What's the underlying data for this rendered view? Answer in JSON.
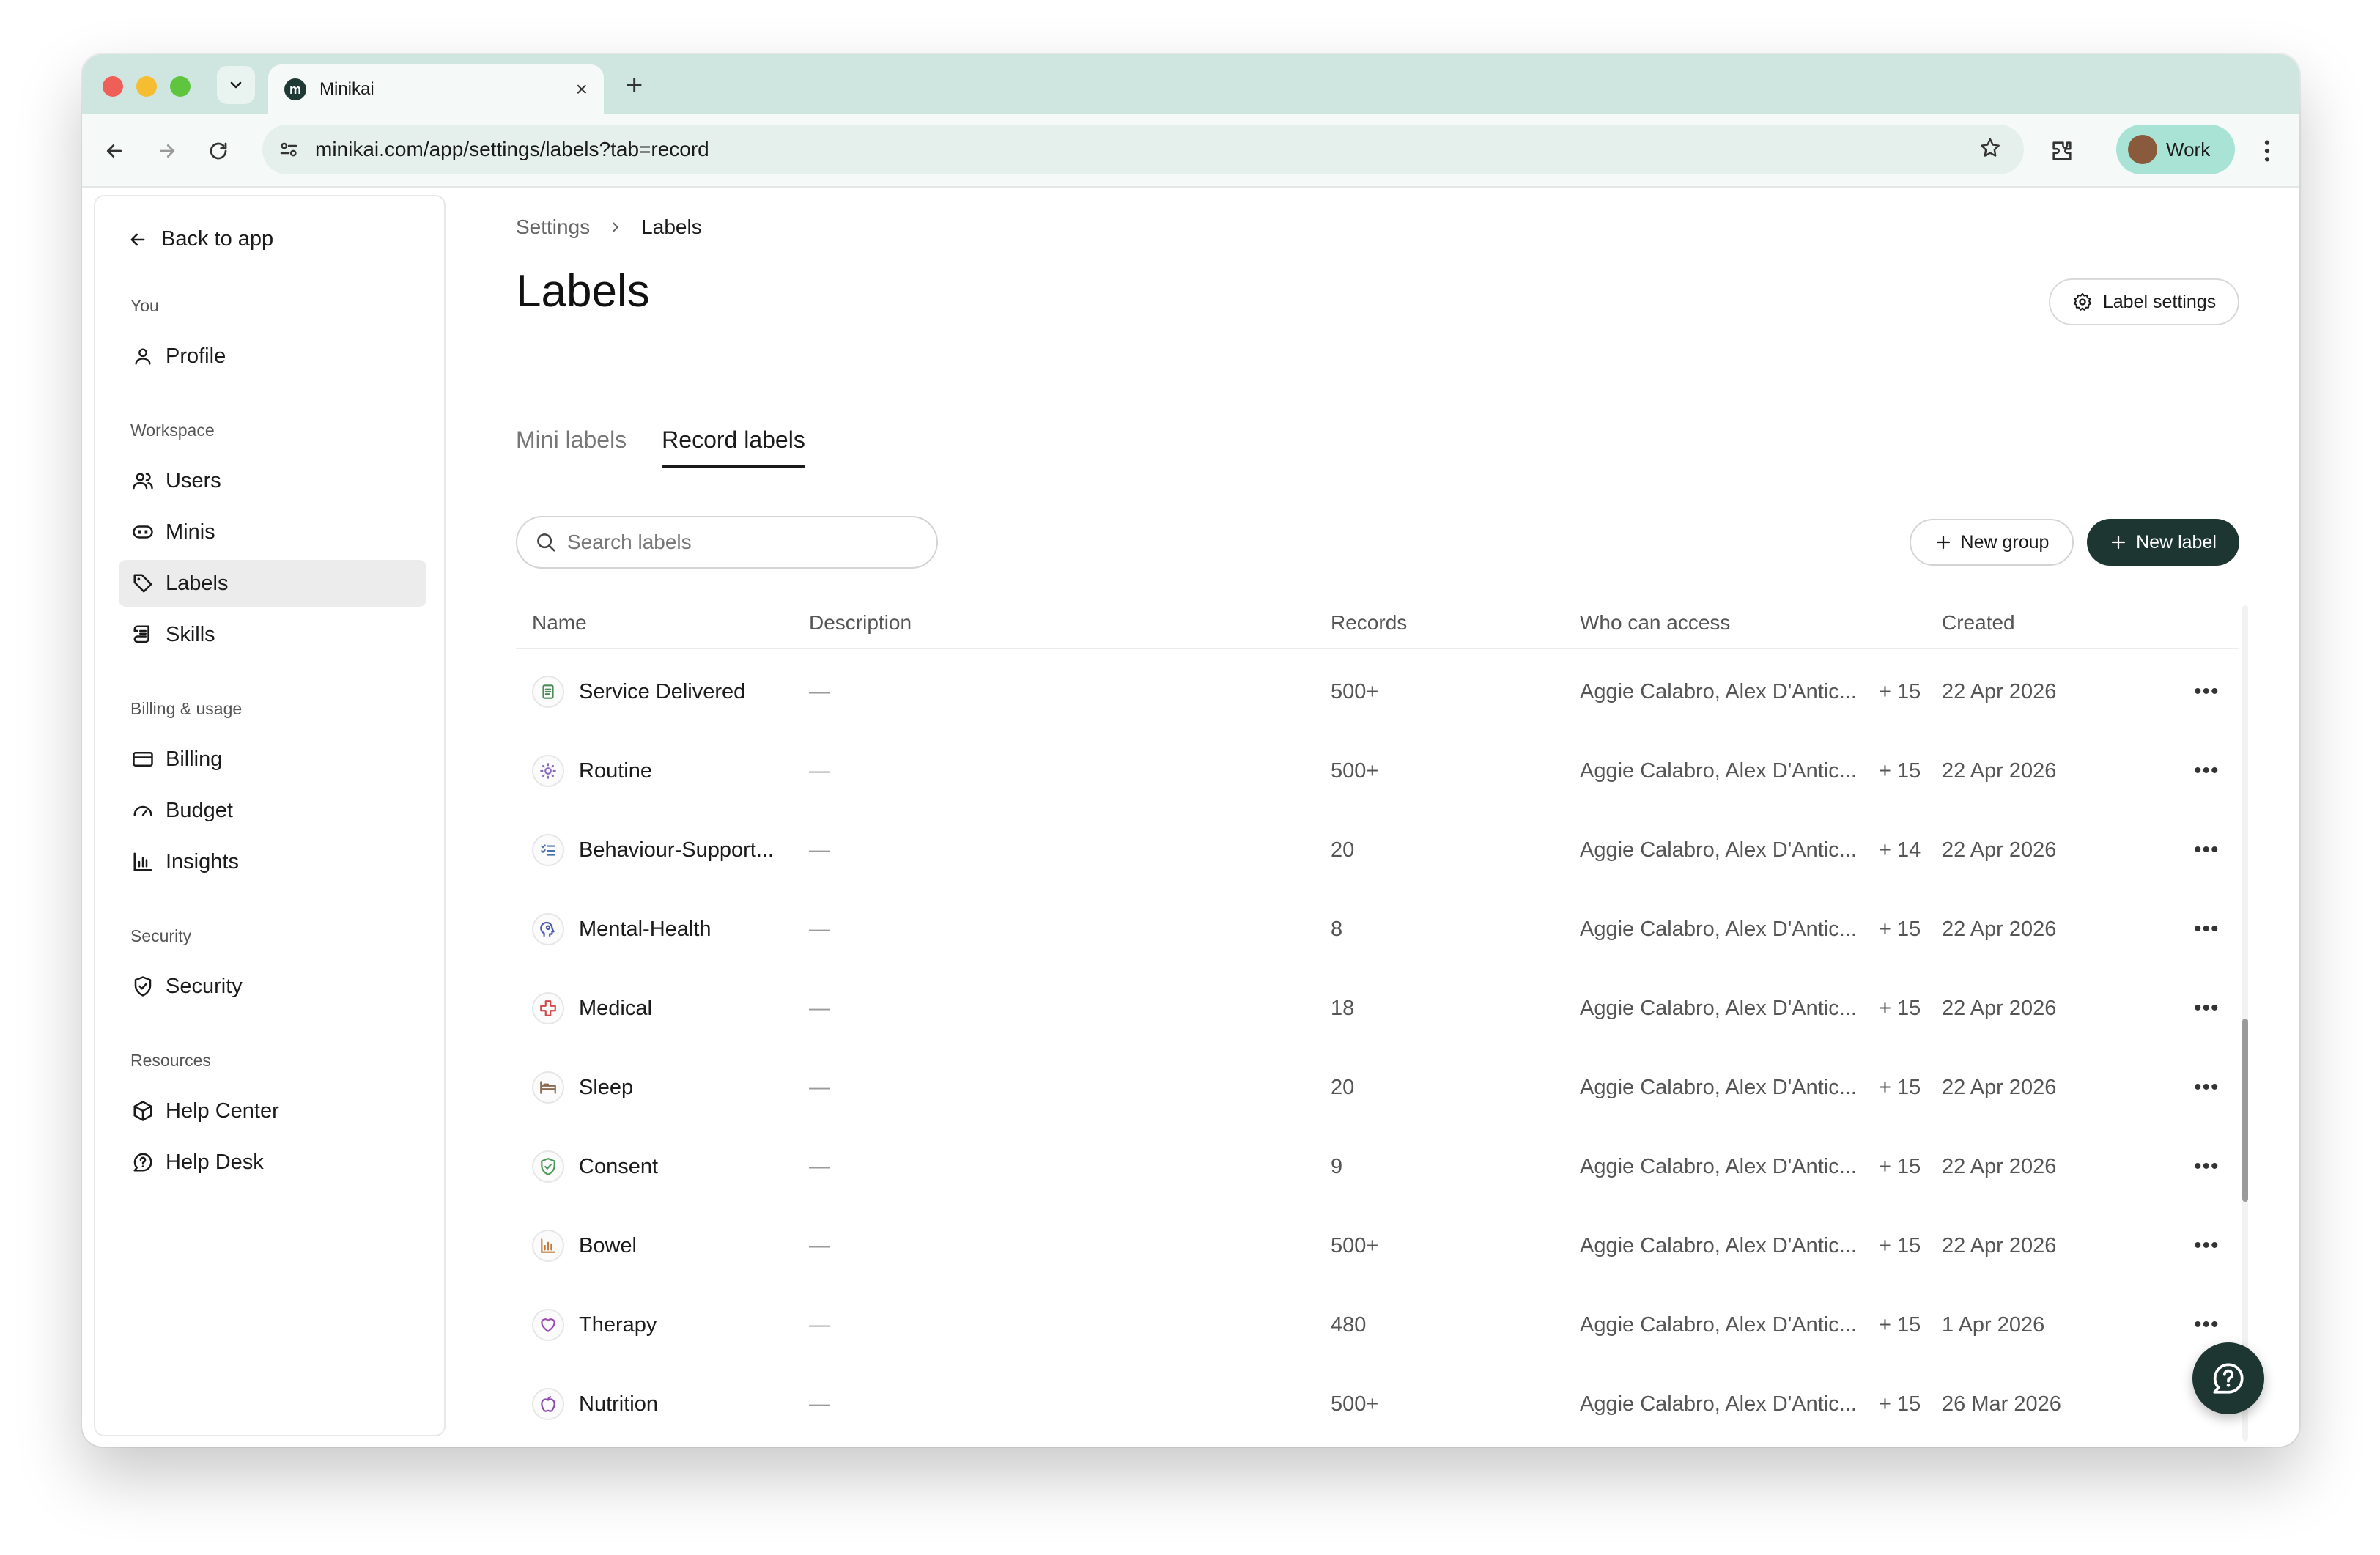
{
  "browser": {
    "tab_title": "Minikai",
    "favicon_letter": "m",
    "url": "minikai.com/app/settings/labels?tab=record",
    "profile_label": "Work"
  },
  "sidebar": {
    "back_label": "Back to app",
    "sections": {
      "you": "You",
      "workspace": "Workspace",
      "billing": "Billing & usage",
      "security": "Security",
      "resources": "Resources"
    },
    "items": {
      "profile": "Profile",
      "users": "Users",
      "minis": "Minis",
      "labels": "Labels",
      "skills": "Skills",
      "billing": "Billing",
      "budget": "Budget",
      "insights": "Insights",
      "security": "Security",
      "help_center": "Help Center",
      "help_desk": "Help Desk"
    },
    "active_item": "labels"
  },
  "main": {
    "breadcrumb": {
      "parent": "Settings",
      "current": "Labels"
    },
    "title": "Labels",
    "label_settings_button": "Label settings",
    "tabs": {
      "mini": "Mini labels",
      "record": "Record labels"
    },
    "active_tab": "record",
    "search": {
      "placeholder": "Search labels",
      "value": ""
    },
    "new_group_button": "New group",
    "new_label_button": "New label",
    "table": {
      "headers": {
        "name": "Name",
        "description": "Description",
        "records": "Records",
        "access": "Who can access",
        "created": "Created"
      },
      "rows": [
        {
          "name": "Service Delivered",
          "icon": "receipt-icon",
          "color": "#4a8a5a",
          "description": "—",
          "records": "500+",
          "access": "Aggie Calabro, Alex D'Antic...",
          "plus": "+ 15",
          "created": "22 Apr 2026"
        },
        {
          "name": "Routine",
          "icon": "sun-icon",
          "color": "#8a6ac0",
          "description": "—",
          "records": "500+",
          "access": "Aggie Calabro, Alex D'Antic...",
          "plus": "+ 15",
          "created": "22 Apr 2026"
        },
        {
          "name": "Behaviour-Support...",
          "icon": "checklist-icon",
          "color": "#4a74b0",
          "description": "—",
          "records": "20",
          "access": "Aggie Calabro, Alex D'Antic...",
          "plus": "+ 14",
          "created": "22 Apr 2026"
        },
        {
          "name": "Mental-Health",
          "icon": "head-icon",
          "color": "#4a5ab0",
          "description": "—",
          "records": "8",
          "access": "Aggie Calabro, Alex D'Antic...",
          "plus": "+ 15",
          "created": "22 Apr 2026"
        },
        {
          "name": "Medical",
          "icon": "medical-cross-icon",
          "color": "#d04a4a",
          "description": "—",
          "records": "18",
          "access": "Aggie Calabro, Alex D'Antic...",
          "plus": "+ 15",
          "created": "22 Apr 2026"
        },
        {
          "name": "Sleep",
          "icon": "bed-icon",
          "color": "#8a6a50",
          "description": "—",
          "records": "20",
          "access": "Aggie Calabro, Alex D'Antic...",
          "plus": "+ 15",
          "created": "22 Apr 2026"
        },
        {
          "name": "Consent",
          "icon": "shield-check-icon",
          "color": "#4a9a5a",
          "description": "—",
          "records": "9",
          "access": "Aggie Calabro, Alex D'Antic...",
          "plus": "+ 15",
          "created": "22 Apr 2026"
        },
        {
          "name": "Bowel",
          "icon": "bar-chart-icon",
          "color": "#c07a3a",
          "description": "—",
          "records": "500+",
          "access": "Aggie Calabro, Alex D'Antic...",
          "plus": "+ 15",
          "created": "22 Apr 2026"
        },
        {
          "name": "Therapy",
          "icon": "heart-hand-icon",
          "color": "#9a4ab0",
          "description": "—",
          "records": "480",
          "access": "Aggie Calabro, Alex D'Antic...",
          "plus": "+ 15",
          "created": "1 Apr 2026"
        },
        {
          "name": "Nutrition",
          "icon": "apple-icon",
          "color": "#8a4ab0",
          "description": "—",
          "records": "500+",
          "access": "Aggie Calabro, Alex D'Antic...",
          "plus": "+ 15",
          "created": "26 Mar 2026"
        }
      ]
    }
  },
  "colors": {
    "tabstrip": "#cfe5df",
    "primary_button": "#1e3631",
    "profile_chip": "#a8e3d6"
  }
}
